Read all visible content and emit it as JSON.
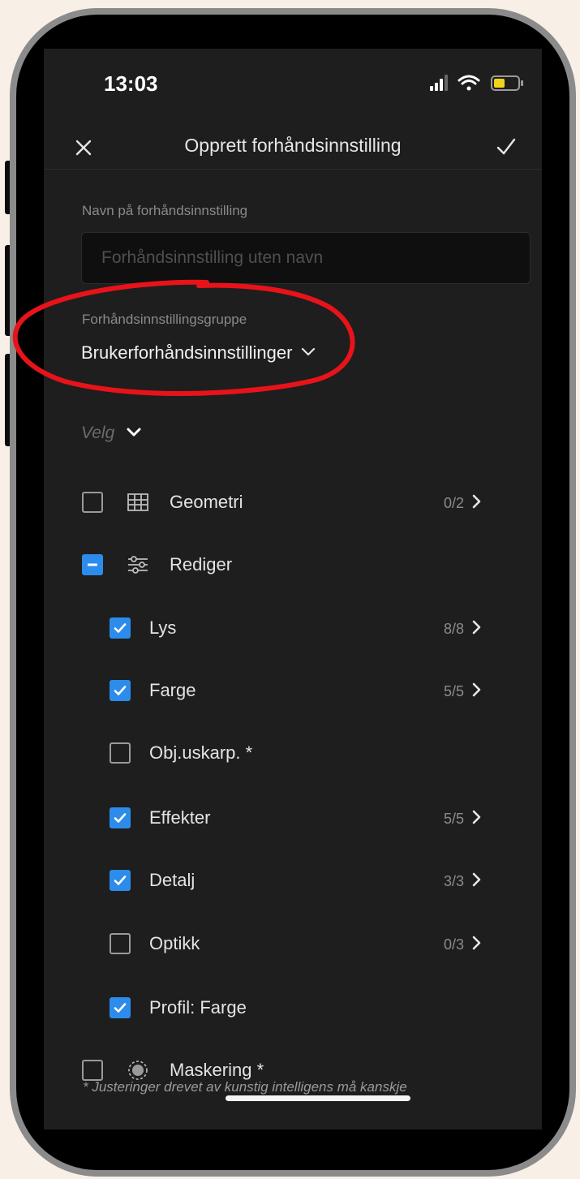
{
  "status_bar": {
    "time": "13:03"
  },
  "nav": {
    "close_icon": "close-icon",
    "title": "Opprett forhåndsinnstilling",
    "confirm_icon": "check-icon"
  },
  "name_field": {
    "label": "Navn på forhåndsinnstilling",
    "placeholder": "Forhåndsinnstilling uten navn",
    "value": ""
  },
  "group_field": {
    "label": "Forhåndsinnstillingsgruppe",
    "value": "Brukerforhåndsinnstillinger"
  },
  "select_menu": {
    "label": "Velg"
  },
  "categories": [
    {
      "label": "Geometri",
      "count": "0/2",
      "state": "unchecked",
      "icon": "grid-icon",
      "chevron": true
    },
    {
      "label": "Rediger",
      "count": "",
      "state": "indeterminate",
      "icon": "sliders-icon",
      "chevron": false
    },
    {
      "label": "Lys",
      "count": "8/8",
      "state": "checked",
      "chevron": true
    },
    {
      "label": "Farge",
      "count": "5/5",
      "state": "checked",
      "chevron": true
    },
    {
      "label": "Obj.uskarp. *",
      "count": "",
      "state": "unchecked",
      "chevron": false
    },
    {
      "label": "Effekter",
      "count": "5/5",
      "state": "checked",
      "chevron": true
    },
    {
      "label": "Detalj",
      "count": "3/3",
      "state": "checked",
      "chevron": true
    },
    {
      "label": "Optikk",
      "count": "0/3",
      "state": "unchecked",
      "chevron": true
    },
    {
      "label": "Profil: Farge",
      "count": "",
      "state": "checked",
      "chevron": false
    },
    {
      "label": "Maskering *",
      "count": "",
      "state": "unchecked",
      "icon": "mask-icon",
      "chevron": false
    }
  ],
  "footer": {
    "note": "* Justeringer drevet av kunstig intelligens må kanskje"
  },
  "colors": {
    "accent": "#2d8ceb",
    "annotation": "#e8131a",
    "background": "#1e1e1e"
  }
}
